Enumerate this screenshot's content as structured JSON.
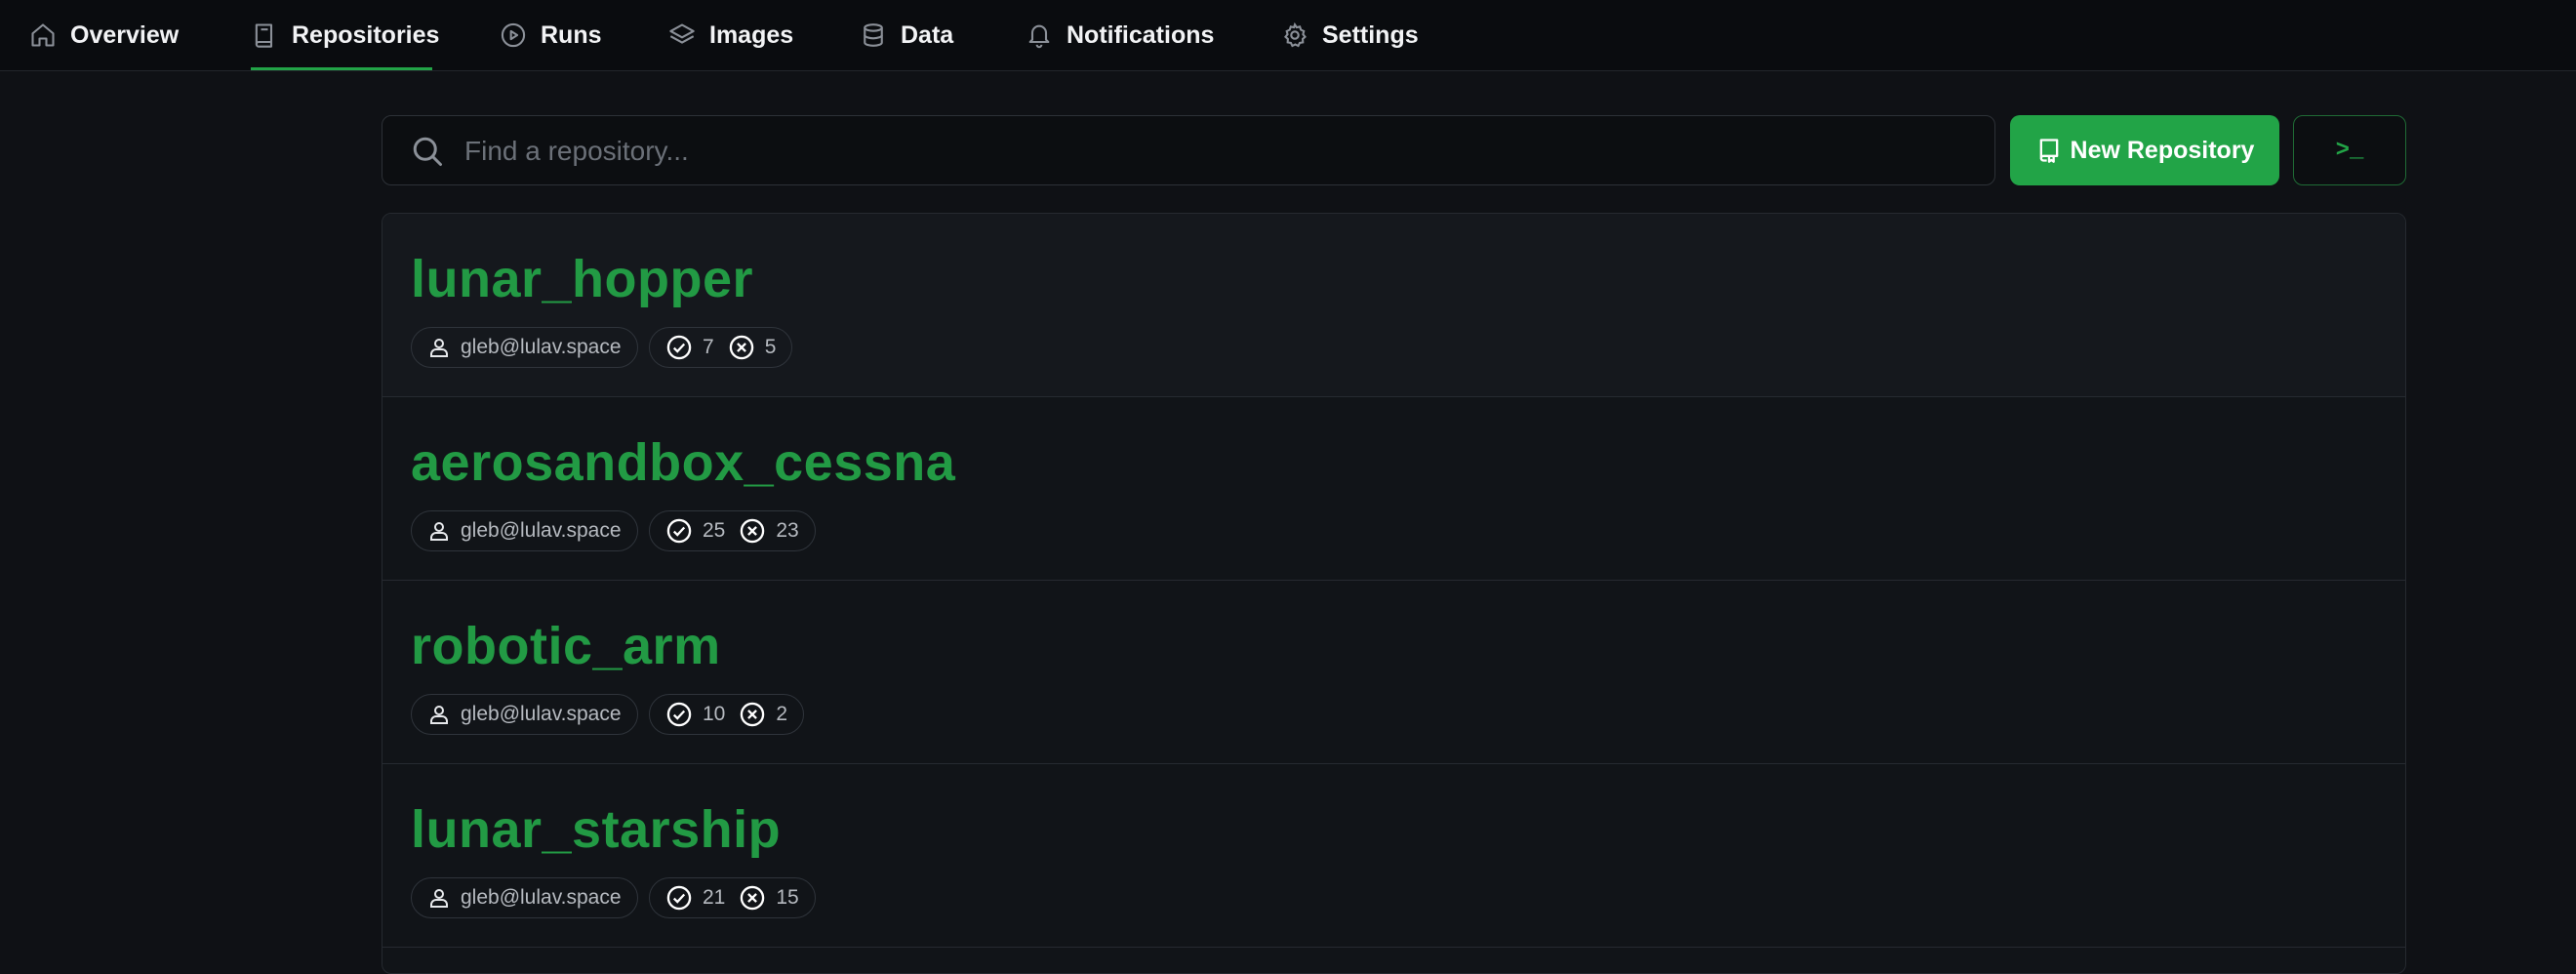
{
  "nav": {
    "tabs": [
      {
        "label": "Overview",
        "icon": "home-icon"
      },
      {
        "label": "Repositories",
        "icon": "book-icon",
        "active": true
      },
      {
        "label": "Runs",
        "icon": "play-icon"
      },
      {
        "label": "Images",
        "icon": "layers-icon"
      },
      {
        "label": "Data",
        "icon": "database-icon"
      },
      {
        "label": "Notifications",
        "icon": "bell-icon"
      },
      {
        "label": "Settings",
        "icon": "gear-icon"
      }
    ]
  },
  "search": {
    "placeholder": "Find a repository..."
  },
  "toolbar": {
    "new_repo_label": "New Repository",
    "terminal_label": ">_"
  },
  "colors": {
    "accent": "#22a447",
    "background": "#0f1115"
  },
  "repos": [
    {
      "name": "lunar_hopper",
      "owner": "gleb@lulav.space",
      "passed": "7",
      "failed": "5"
    },
    {
      "name": "aerosandbox_cessna",
      "owner": "gleb@lulav.space",
      "passed": "25",
      "failed": "23"
    },
    {
      "name": "robotic_arm",
      "owner": "gleb@lulav.space",
      "passed": "10",
      "failed": "2"
    },
    {
      "name": "lunar_starship",
      "owner": "gleb@lulav.space",
      "passed": "21",
      "failed": "15"
    }
  ]
}
